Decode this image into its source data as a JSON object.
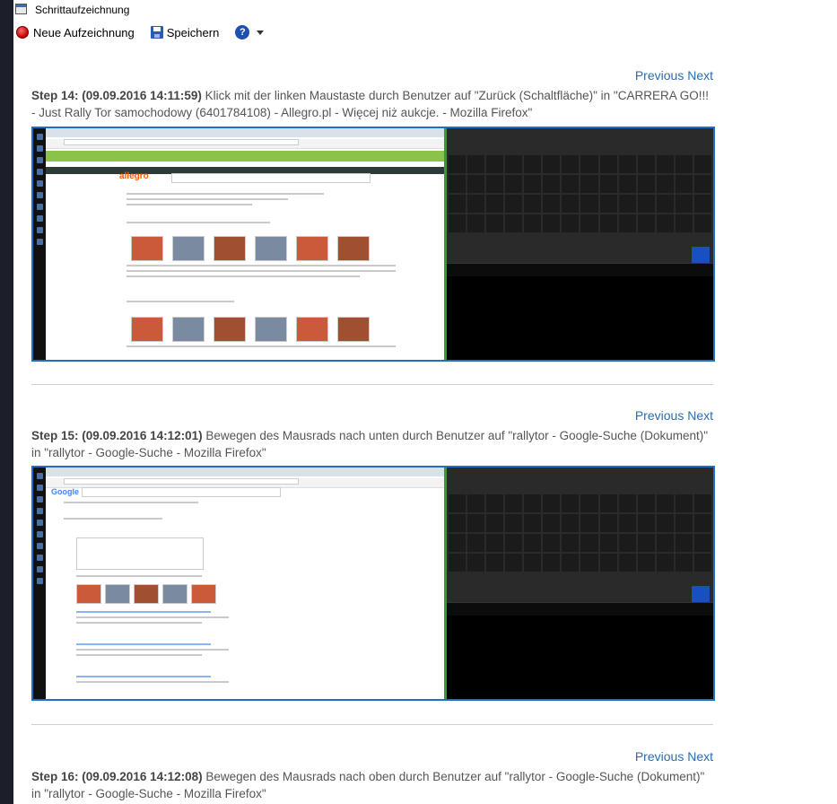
{
  "window": {
    "title": "Schrittaufzeichnung"
  },
  "toolbar": {
    "new_recording": "Neue Aufzeichnung",
    "save": "Speichern",
    "help": "?"
  },
  "nav": {
    "previous": "Previous",
    "next": "Next"
  },
  "steps": [
    {
      "header": "Step 14: (09.09.2016 14:11:59)",
      "description": " Klick mit der linken Maustaste durch Benutzer auf \"Zurück (Schaltfläche)\" in \"CARRERA GO!!! - Just Rally Tor samochodowy (6401784108) - Allegro.pl - Więcej niż aukcje. - Mozilla Firefox\"",
      "screenshot": "allegro-page"
    },
    {
      "header": "Step 15: (09.09.2016 14:12:01)",
      "description": " Bewegen des Mausrads nach unten durch Benutzer auf \"rallytor - Google-Suche (Dokument)\" in \"rallytor - Google-Suche - Mozilla Firefox\"",
      "screenshot": "google-search-page"
    },
    {
      "header": "Step 16: (09.09.2016 14:12:08)",
      "description": " Bewegen des Mausrads nach oben durch Benutzer auf \"rallytor - Google-Suche (Dokument)\" in \"rallytor - Google-Suche - Mozilla Firefox\""
    }
  ],
  "colors": {
    "accent": "#1e6fc8",
    "link": "#2b6cb0",
    "record": "#c00000"
  }
}
